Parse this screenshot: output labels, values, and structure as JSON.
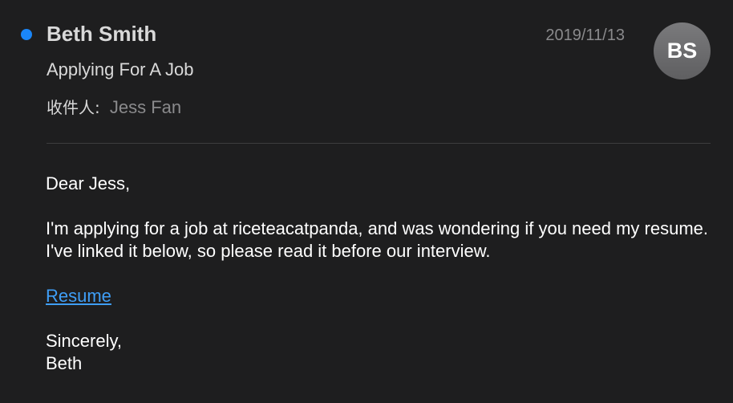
{
  "header": {
    "sender": "Beth Smith",
    "date": "2019/11/13",
    "avatar_initials": "BS",
    "subject": "Applying For A Job",
    "recipient_label": "收件人:",
    "recipient_name": "Jess Fan",
    "unread": true
  },
  "body": {
    "greeting": "Dear Jess,",
    "paragraph": "I'm applying for a job at riceteacatpanda, and was wondering if you need my resume. I've linked it below, so please read it before our interview.",
    "link_label": "Resume",
    "closing": "Sincerely,",
    "signature": "Beth"
  },
  "colors": {
    "background": "#1e1e1f",
    "unread_dot": "#1a86f8",
    "link": "#3f9ef6",
    "muted_text": "#8a8a8c"
  }
}
